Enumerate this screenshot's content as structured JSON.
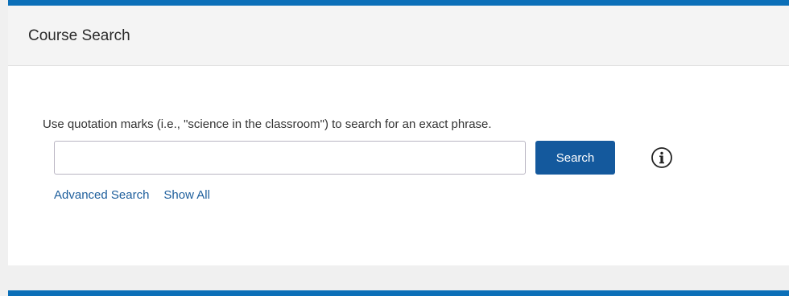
{
  "header": {
    "title": "Course Search"
  },
  "search": {
    "hint": "Use quotation marks (i.e., \"science in the classroom\") to search for an exact phrase.",
    "input_value": "",
    "placeholder": "",
    "button_label": "Search",
    "info_icon": "info-circle-icon"
  },
  "links": {
    "advanced": "Advanced Search",
    "show_all": "Show All"
  },
  "colors": {
    "accent": "#0b6fb8",
    "button": "#14599d",
    "link": "#1d5e9c"
  }
}
